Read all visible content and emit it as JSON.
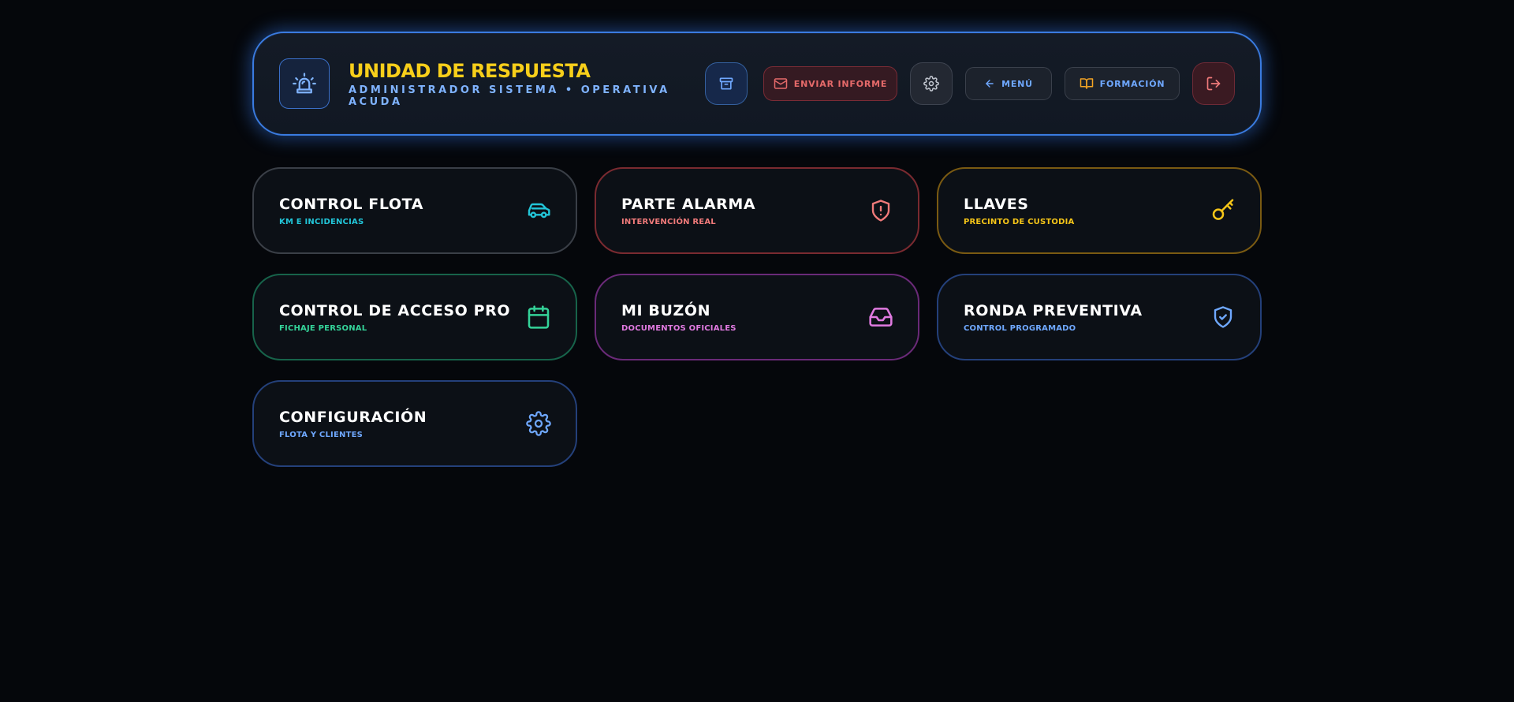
{
  "header": {
    "title": "UNIDAD DE RESPUESTA",
    "subtitle": "ADMINISTRADOR SISTEMA • OPERATIVA ACUDA",
    "brand_icon": "siren-icon",
    "actions": {
      "archive_icon": "archive-icon",
      "report_label": "ENVIAR INFORME",
      "report_icon": "mail-icon",
      "settings_icon": "gear-icon",
      "menu_label": "MENÚ",
      "menu_icon": "arrow-left-icon",
      "training_label": "FORMACIÓN",
      "training_icon": "book-open-icon",
      "logout_icon": "logout-icon"
    }
  },
  "cards": [
    {
      "title": "CONTROL FLOTA",
      "subtitle": "KM E INCIDENCIAS",
      "icon": "car-icon",
      "accent": "#22c5d8",
      "border": "#3a3f47"
    },
    {
      "title": "PARTE ALARMA",
      "subtitle": "INTERVENCIÓN REAL",
      "icon": "shield-alert-icon",
      "accent": "#f07a7a",
      "border": "#7a2a30"
    },
    {
      "title": "LLAVES",
      "subtitle": "PRECINTO DE CUSTODIA",
      "icon": "key-icon",
      "accent": "#f5c518",
      "border": "#7a5a12"
    },
    {
      "title": "CONTROL DE ACCESO PRO",
      "subtitle": "FICHAJE PERSONAL",
      "icon": "calendar-icon",
      "accent": "#34d399",
      "border": "#17634a"
    },
    {
      "title": "MI BUZÓN",
      "subtitle": "DOCUMENTOS OFICIALES",
      "icon": "inbox-icon",
      "accent": "#e07ae0",
      "border": "#6a2a78"
    },
    {
      "title": "RONDA PREVENTIVA",
      "subtitle": "CONTROL PROGRAMADO",
      "icon": "shield-check-icon",
      "accent": "#6fa8ff",
      "border": "#24407a"
    },
    {
      "title": "CONFIGURACIÓN",
      "subtitle": "FLOTA Y CLIENTES",
      "icon": "gear-icon",
      "accent": "#6fa8ff",
      "border": "#24407a"
    }
  ]
}
